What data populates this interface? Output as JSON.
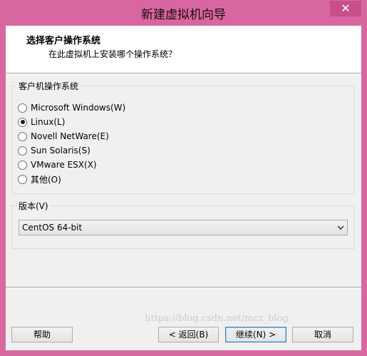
{
  "window": {
    "title": "新建虚拟机向导",
    "close_symbol": "✕"
  },
  "header": {
    "title": "选择客户操作系统",
    "subtitle": "在此虚拟机上安装哪个操作系统？"
  },
  "os_group": {
    "label": "客户机操作系统",
    "options": [
      {
        "label": "Microsoft Windows(W)",
        "checked": false
      },
      {
        "label": "Linux(L)",
        "checked": true
      },
      {
        "label": "Novell NetWare(E)",
        "checked": false
      },
      {
        "label": "Sun Solaris(S)",
        "checked": false
      },
      {
        "label": "VMware ESX(X)",
        "checked": false
      },
      {
        "label": "其他(O)",
        "checked": false
      }
    ]
  },
  "version_group": {
    "label": "版本(V)",
    "selected": "CentOS 64-bit",
    "dropdown_icon": "chevron-down-icon"
  },
  "buttons": {
    "help": "帮助",
    "back": "< 返回(B)",
    "next": "继续(N) >",
    "cancel": "取消"
  },
  "watermark": "https://blog.csdn.net/mcz_blog",
  "colors": {
    "title_bar": "#d9679f",
    "client_bg": "#f0f0f0"
  }
}
